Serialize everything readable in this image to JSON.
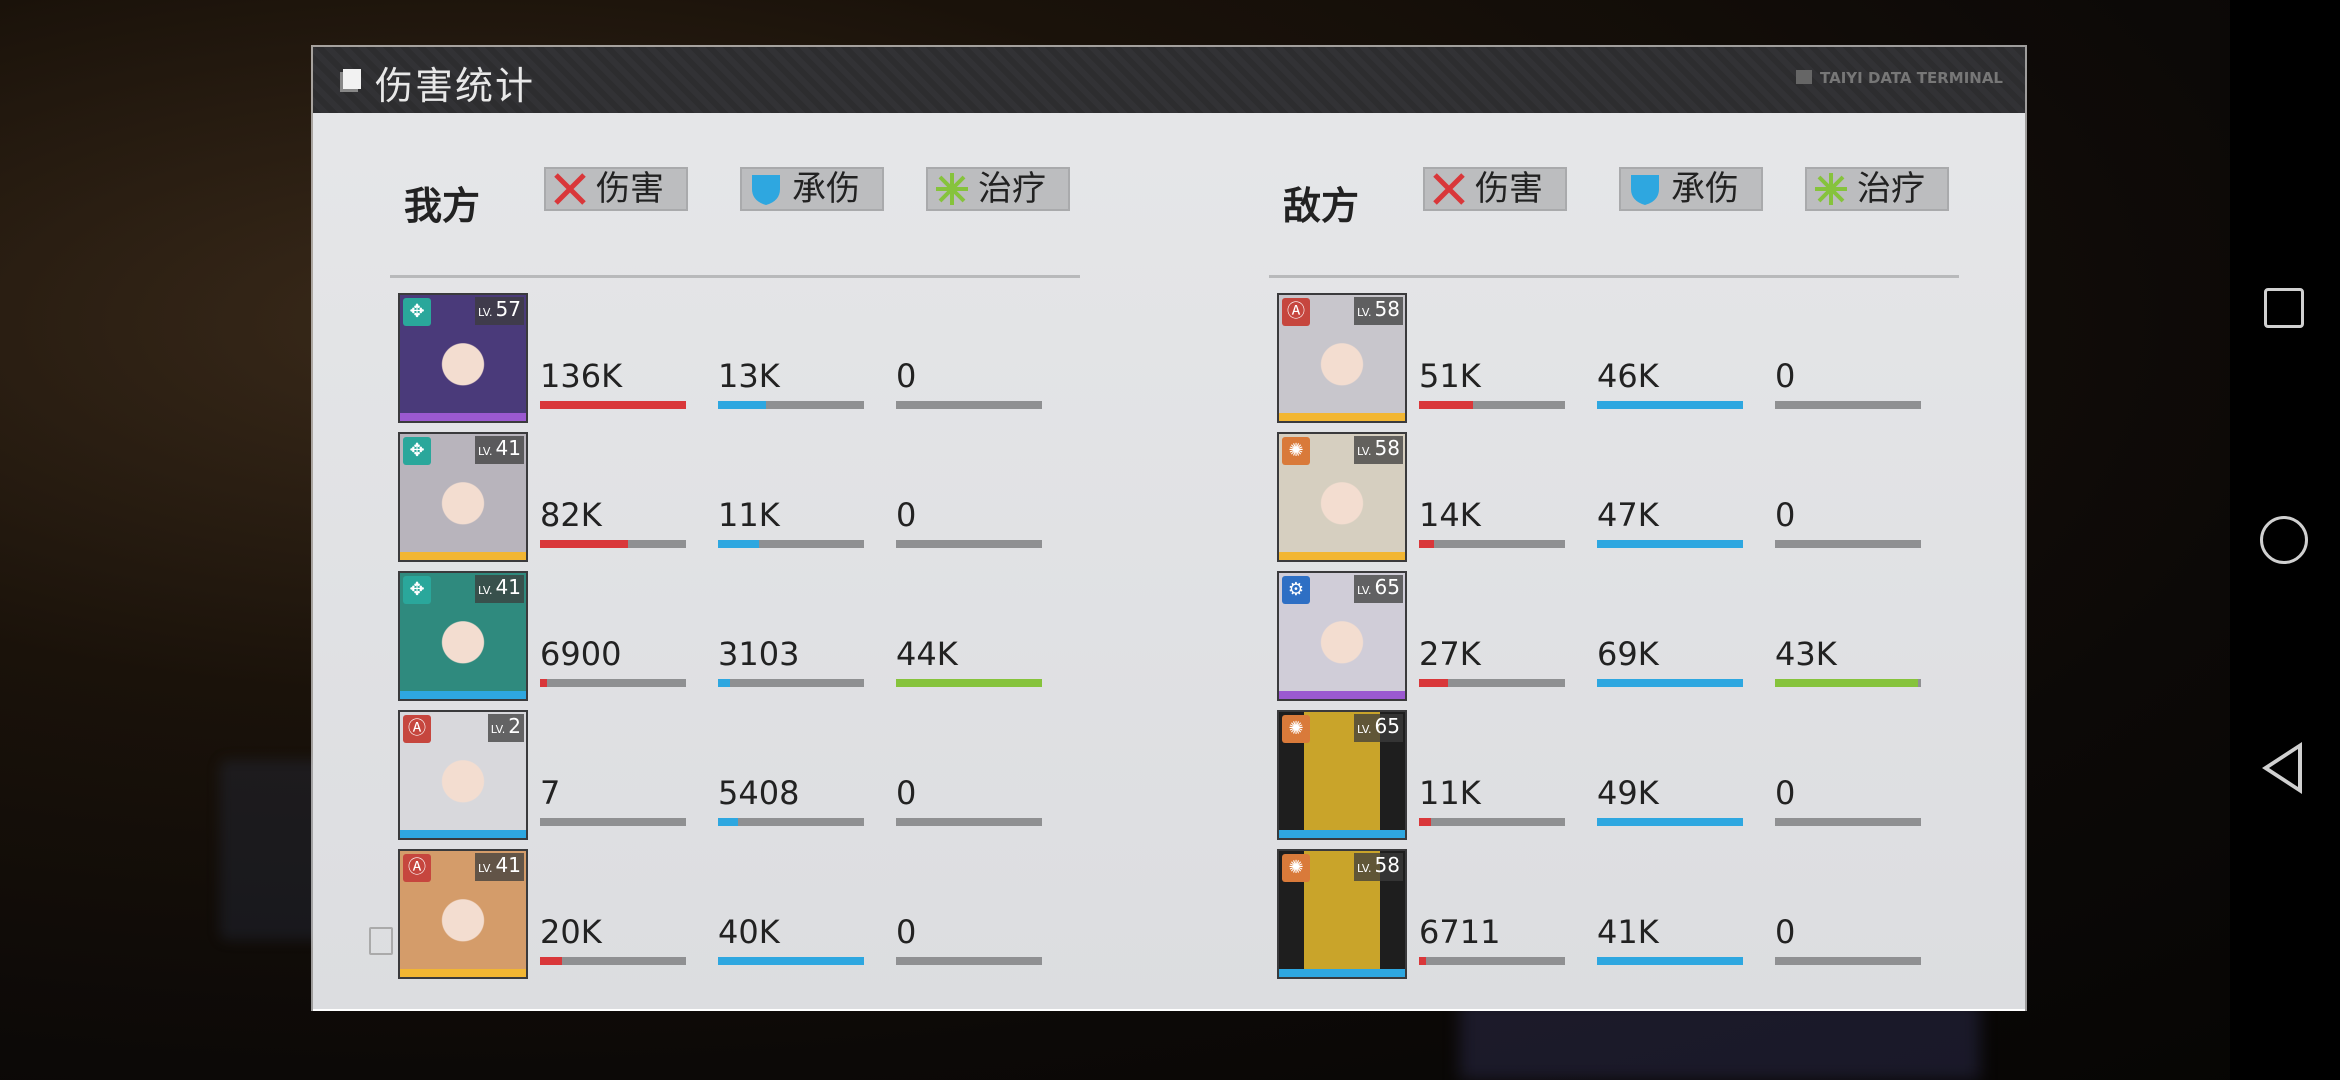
{
  "header": {
    "title": "伤害统计",
    "tag": "TAIYI DATA TERMINAL"
  },
  "columns": {
    "damage": "伤害",
    "taken": "承伤",
    "heal": "治疗"
  },
  "colors": {
    "damage": "#d9373a",
    "taken": "#2ea7e0",
    "heal": "#86c33c"
  },
  "ally": {
    "title": "我方",
    "rows": [
      {
        "lv_prefix": "LV.",
        "level": "57",
        "element": "diamond-icon",
        "rarity_color": "#9b59d0",
        "damage": "136K",
        "damage_fill": 1.0,
        "taken": "13K",
        "taken_fill": 0.33,
        "heal": "0",
        "heal_fill": 0
      },
      {
        "lv_prefix": "LV.",
        "level": "41",
        "element": "diamond-icon",
        "rarity_color": "#f2b632",
        "damage": "82K",
        "damage_fill": 0.6,
        "taken": "11K",
        "taken_fill": 0.28,
        "heal": "0",
        "heal_fill": 0
      },
      {
        "lv_prefix": "LV.",
        "level": "41",
        "element": "diamond-icon",
        "rarity_color": "#2ea7e0",
        "damage": "6900",
        "damage_fill": 0.05,
        "taken": "3103",
        "taken_fill": 0.08,
        "heal": "44K",
        "heal_fill": 1.0
      },
      {
        "lv_prefix": "LV.",
        "level": "2",
        "element": "tower-icon",
        "rarity_color": "#2ea7e0",
        "damage": "7",
        "damage_fill": 0,
        "taken": "5408",
        "taken_fill": 0.14,
        "heal": "0",
        "heal_fill": 0
      },
      {
        "lv_prefix": "LV.",
        "level": "41",
        "element": "tower-icon",
        "rarity_color": "#f2b632",
        "damage": "20K",
        "damage_fill": 0.15,
        "taken": "40K",
        "taken_fill": 1.0,
        "heal": "0",
        "heal_fill": 0
      }
    ]
  },
  "enemy": {
    "title": "敌方",
    "rows": [
      {
        "lv_prefix": "LV.",
        "level": "58",
        "element": "tower-icon",
        "rarity_color": "#f2b632",
        "damage": "51K",
        "damage_fill": 0.37,
        "taken": "46K",
        "taken_fill": 1.0,
        "heal": "0",
        "heal_fill": 0
      },
      {
        "lv_prefix": "LV.",
        "level": "58",
        "element": "flame-icon",
        "rarity_color": "#f2b632",
        "damage": "14K",
        "damage_fill": 0.1,
        "taken": "47K",
        "taken_fill": 1.0,
        "heal": "0",
        "heal_fill": 0
      },
      {
        "lv_prefix": "LV.",
        "level": "65",
        "element": "gear-icon",
        "rarity_color": "#9b59d0",
        "damage": "27K",
        "damage_fill": 0.2,
        "taken": "69K",
        "taken_fill": 1.0,
        "heal": "43K",
        "heal_fill": 0.98
      },
      {
        "lv_prefix": "LV.",
        "level": "65",
        "element": "flame-icon",
        "rarity_color": "#2ea7e0",
        "damage": "11K",
        "damage_fill": 0.08,
        "taken": "49K",
        "taken_fill": 1.0,
        "heal": "0",
        "heal_fill": 0
      },
      {
        "lv_prefix": "LV.",
        "level": "58",
        "element": "flame-icon",
        "rarity_color": "#2ea7e0",
        "damage": "6711",
        "damage_fill": 0.05,
        "taken": "41K",
        "taken_fill": 1.0,
        "heal": "0",
        "heal_fill": 0
      }
    ]
  }
}
